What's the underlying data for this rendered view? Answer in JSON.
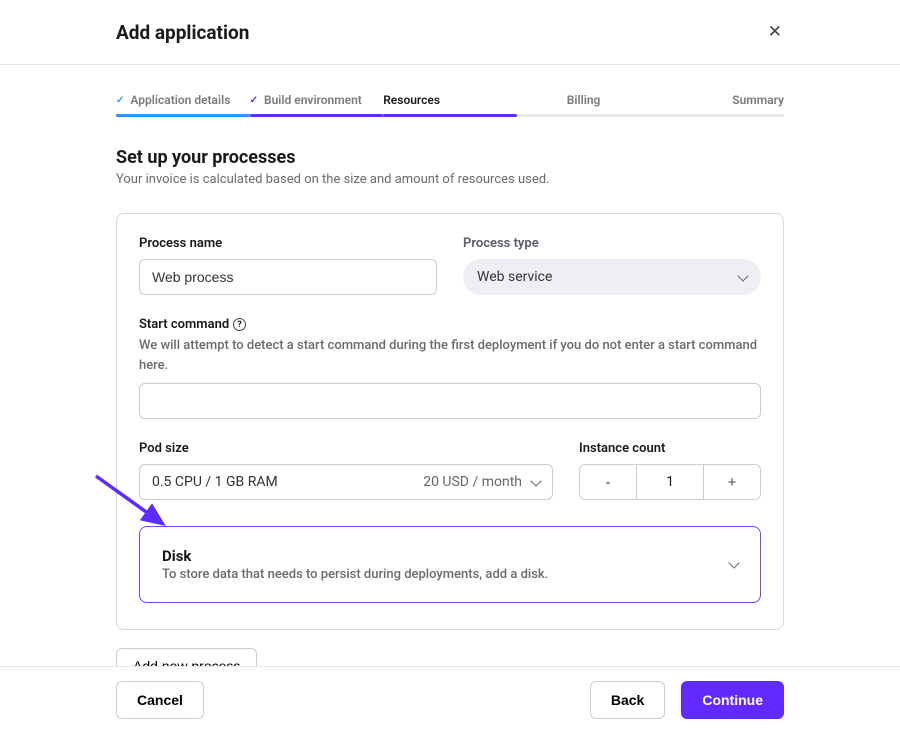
{
  "header": {
    "title": "Add application"
  },
  "steps": [
    {
      "label": "Application details",
      "state": "done"
    },
    {
      "label": "Build environment",
      "state": "done"
    },
    {
      "label": "Resources",
      "state": "active"
    },
    {
      "label": "Billing",
      "state": "future"
    },
    {
      "label": "Summary",
      "state": "future"
    }
  ],
  "section": {
    "title": "Set up your processes",
    "subtitle": "Your invoice is calculated based on the size and amount of resources used."
  },
  "process": {
    "name_label": "Process name",
    "name_value": "Web process",
    "type_label": "Process type",
    "type_value": "Web service",
    "start_label": "Start command",
    "start_help": "We will attempt to detect a start command during the first deployment if you do not enter a start command here.",
    "start_value": "",
    "pod_label": "Pod size",
    "pod_value": "0.5 CPU / 1 GB RAM",
    "pod_price": "20 USD / month",
    "instance_label": "Instance count",
    "instance_count": "1",
    "disk_title": "Disk",
    "disk_sub": "To store data that needs to persist during deployments, add a disk."
  },
  "actions": {
    "add_process": "Add new process",
    "cancel": "Cancel",
    "back": "Back",
    "continue": "Continue"
  },
  "colors": {
    "accent": "#612bff",
    "step_blue": "#2c93ff"
  }
}
